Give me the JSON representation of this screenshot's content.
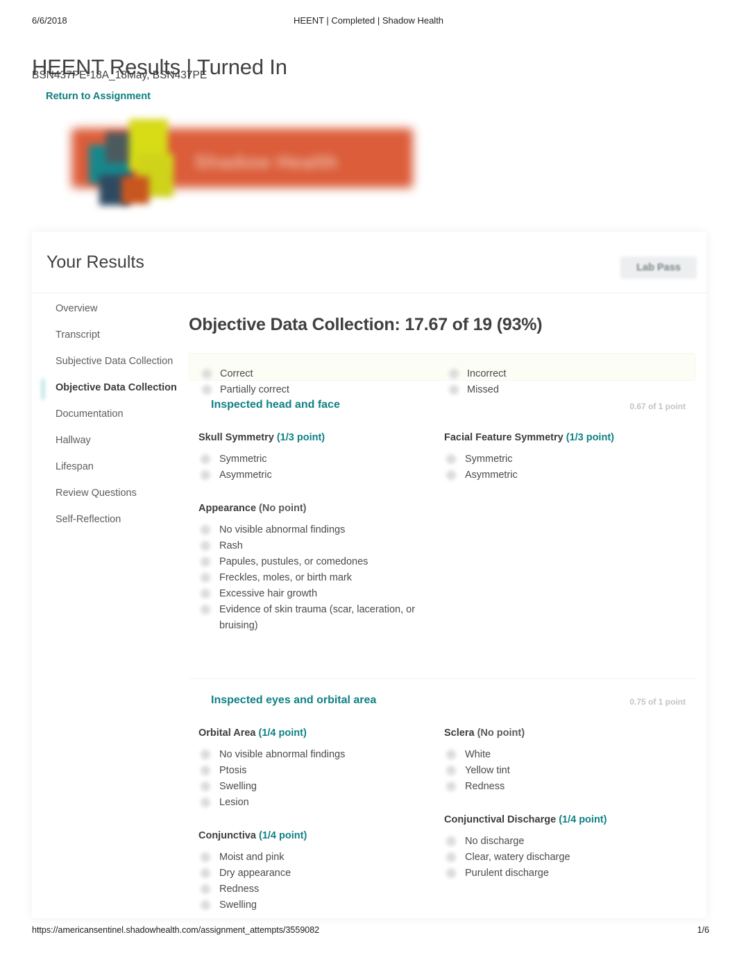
{
  "print_header": {
    "date": "6/6/2018",
    "title": "HEENT | Completed | Shadow Health"
  },
  "page": {
    "title": "HEENT Results | Turned In",
    "subtitle": "BSN437PE-18A_18May, BSN437PE",
    "return_link": "Return to Assignment"
  },
  "brand": {
    "name": "Shadow Health",
    "logo_icon": "puzzle-pieces-icon",
    "banner_color": "#d9512c"
  },
  "results": {
    "heading": "Your Results",
    "lab_pass_label": "Lab Pass"
  },
  "sidebar": {
    "items": [
      {
        "label": "Overview",
        "active": false
      },
      {
        "label": "Transcript",
        "active": false
      },
      {
        "label": "Subjective Data Collection",
        "active": false
      },
      {
        "label": "Objective Data Collection",
        "active": true
      },
      {
        "label": "Documentation",
        "active": false
      },
      {
        "label": "Hallway",
        "active": false
      },
      {
        "label": "Lifespan",
        "active": false
      },
      {
        "label": "Review Questions",
        "active": false
      },
      {
        "label": "Self-Reflection",
        "active": false
      }
    ]
  },
  "main": {
    "title": "Objective Data Collection: 17.67 of 19 (93%)",
    "legend": {
      "col1": [
        "Correct",
        "Partially correct"
      ],
      "col2": [
        "Incorrect",
        "Missed"
      ]
    },
    "sections": [
      {
        "name": "Inspected head and face",
        "points": "0.67 of 1 point",
        "groups": [
          {
            "title": "Skull Symmetry",
            "points": "(1/3 point)",
            "points_earned": true,
            "options": [
              "Symmetric",
              "Asymmetric"
            ]
          },
          {
            "title": "Facial Feature Symmetry",
            "points": "(1/3 point)",
            "points_earned": true,
            "options": [
              "Symmetric",
              "Asymmetric"
            ]
          },
          {
            "title": "Appearance",
            "points": "(No point)",
            "points_earned": false,
            "options": [
              "No visible abnormal findings",
              "Rash",
              "Papules, pustules, or comedones",
              "Freckles, moles, or birth mark",
              "Excessive hair growth",
              "Evidence of skin trauma (scar, laceration, or bruising)"
            ]
          }
        ]
      },
      {
        "name": "Inspected eyes and orbital area",
        "points": "0.75 of 1 point",
        "groups": [
          {
            "title": "Orbital Area",
            "points": "(1/4 point)",
            "points_earned": true,
            "options": [
              "No visible abnormal findings",
              "Ptosis",
              "Swelling",
              "Lesion"
            ]
          },
          {
            "title": "Sclera",
            "points": "(No point)",
            "points_earned": false,
            "options": [
              "White",
              "Yellow tint",
              "Redness"
            ]
          },
          {
            "title": "Conjunctiva",
            "points": "(1/4 point)",
            "points_earned": true,
            "options": [
              "Moist and pink",
              "Dry appearance",
              "Redness",
              "Swelling"
            ]
          },
          {
            "title": "Conjunctival Discharge",
            "points": "(1/4 point)",
            "points_earned": true,
            "options": [
              "No discharge",
              "Clear, watery discharge",
              "Purulent discharge"
            ]
          }
        ]
      }
    ]
  },
  "footer": {
    "url": "https://americansentinel.shadowhealth.com/assignment_attempts/3559082",
    "page_number": "1/6"
  },
  "colors": {
    "teal": "#0f8084",
    "brand_orange": "#d9512c",
    "muted": "#c3c3c3"
  }
}
